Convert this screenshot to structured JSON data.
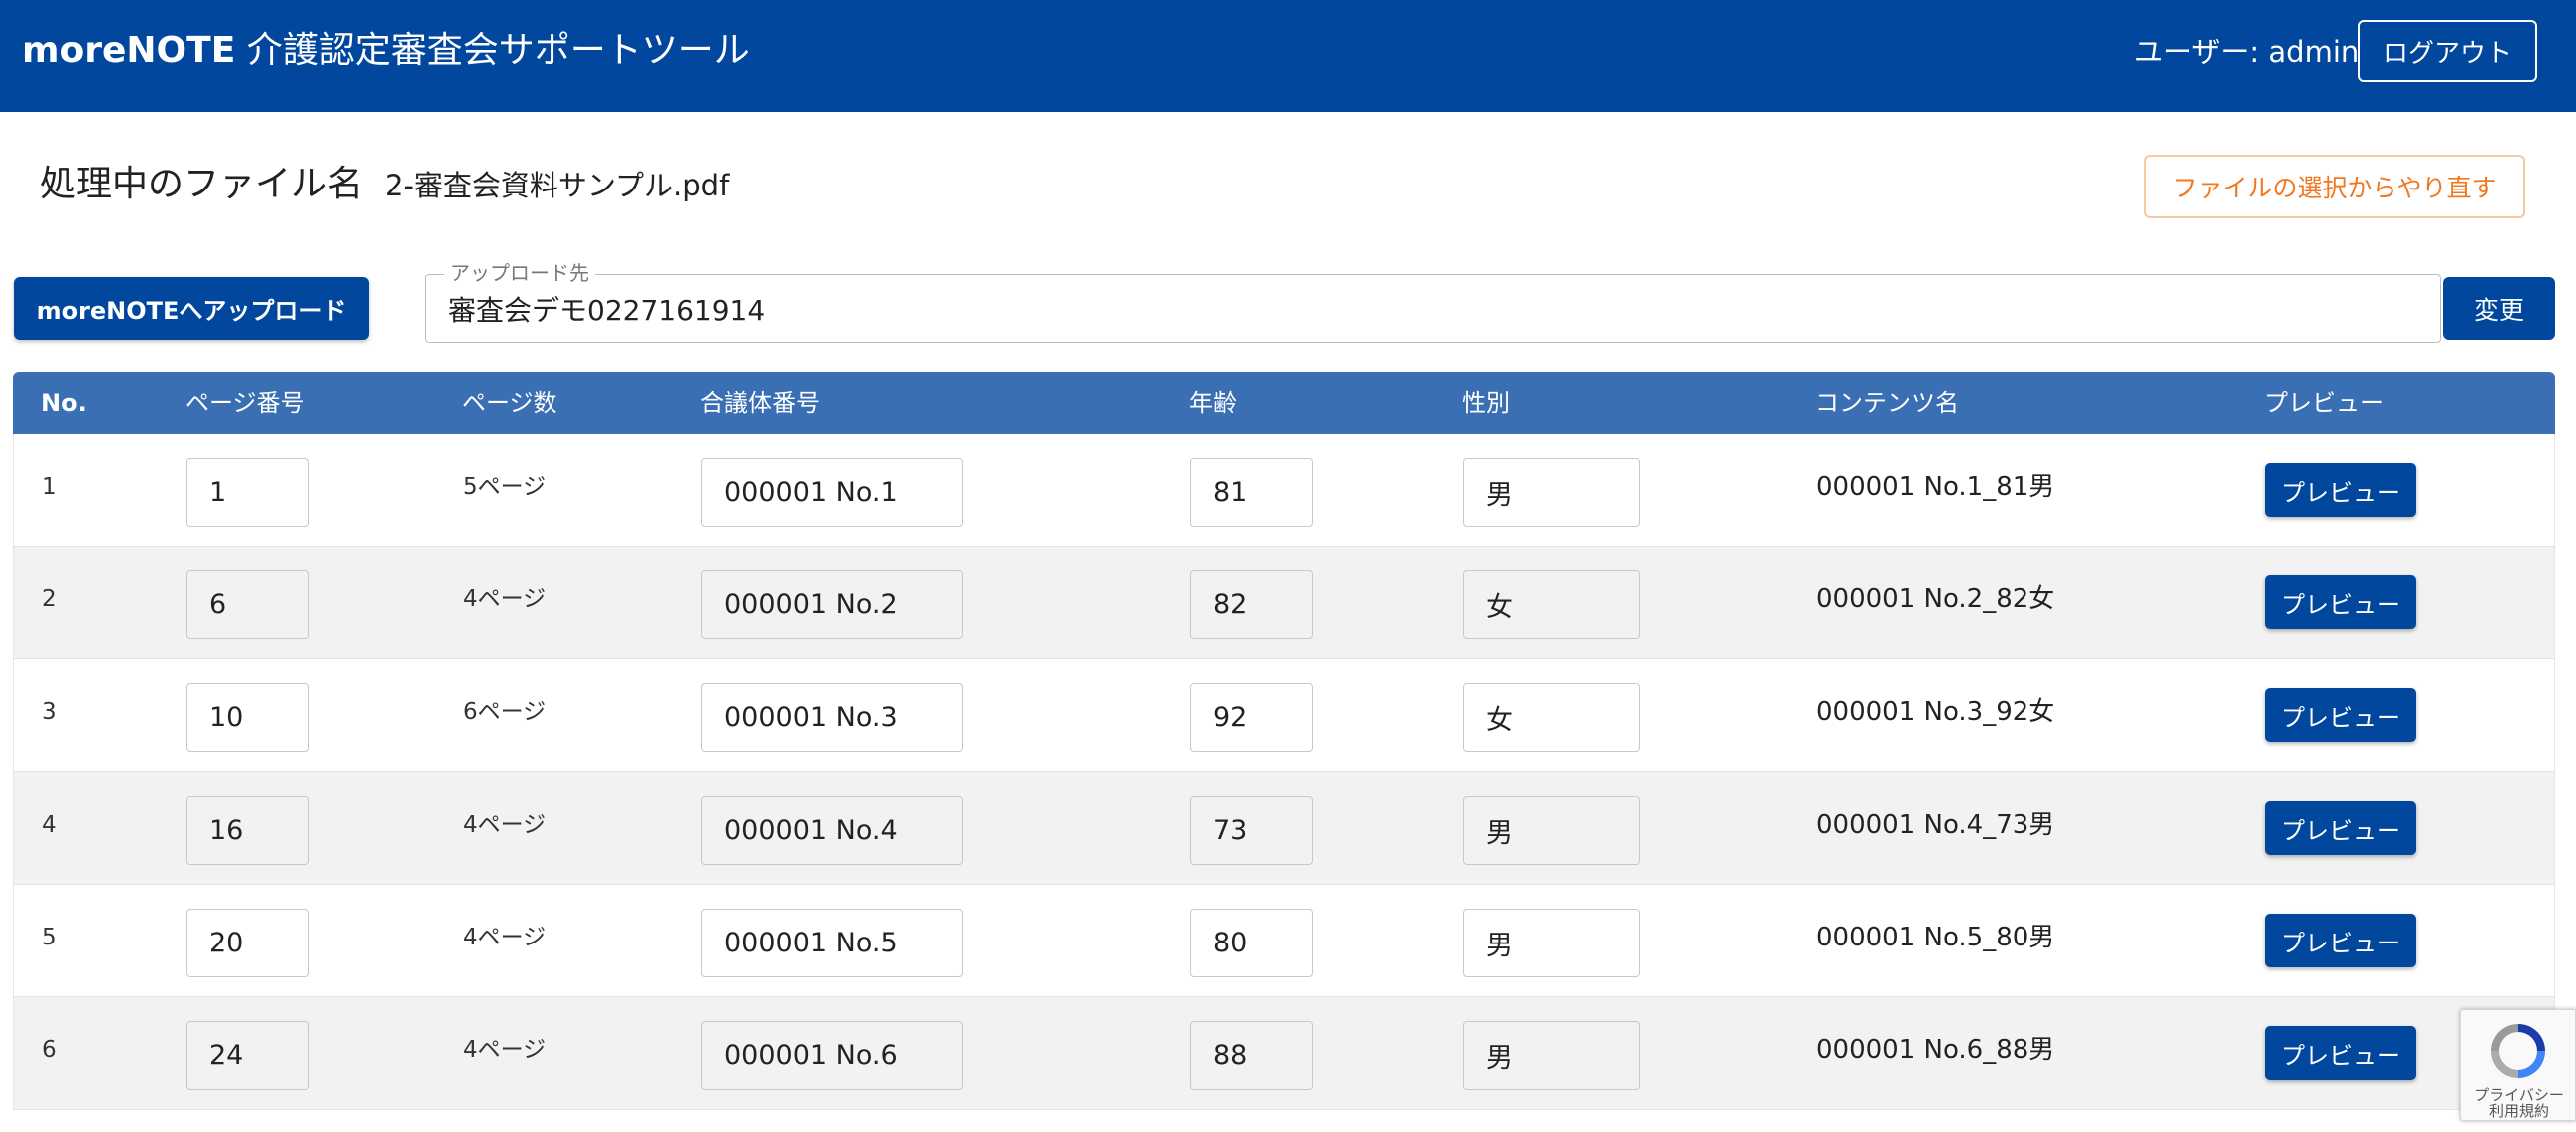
{
  "header": {
    "brand": "moreNOTE",
    "title_suffix": " 介護認定審査会サポートツール",
    "user_label": "ユーザー: admin",
    "logout_label": "ログアウト"
  },
  "file": {
    "heading": "処理中のファイル名",
    "name": "2-審査会資料サンプル.pdf",
    "reset_label": "ファイルの選択からやり直す"
  },
  "upload": {
    "button_label": "moreNOTEへアップロード",
    "destination_legend": "アップロード先",
    "destination_value": "審査会デモ0227161914",
    "change_label": "変更"
  },
  "table": {
    "headers": [
      "No.",
      "ページ番号",
      "ページ数",
      "合議体番号",
      "年齢",
      "性別",
      "コンテンツ名",
      "プレビュー"
    ],
    "rows": [
      {
        "no": "1",
        "page": "1",
        "pages": "5ページ",
        "group": "000001 No.1",
        "age": "81",
        "sex": "男",
        "content": "000001 No.1_81男",
        "preview": "プレビュー"
      },
      {
        "no": "2",
        "page": "6",
        "pages": "4ページ",
        "group": "000001 No.2",
        "age": "82",
        "sex": "女",
        "content": "000001 No.2_82女",
        "preview": "プレビュー"
      },
      {
        "no": "3",
        "page": "10",
        "pages": "6ページ",
        "group": "000001 No.3",
        "age": "92",
        "sex": "女",
        "content": "000001 No.3_92女",
        "preview": "プレビュー"
      },
      {
        "no": "4",
        "page": "16",
        "pages": "4ページ",
        "group": "000001 No.4",
        "age": "73",
        "sex": "男",
        "content": "000001 No.4_73男",
        "preview": "プレビュー"
      },
      {
        "no": "5",
        "page": "20",
        "pages": "4ページ",
        "group": "000001 No.5",
        "age": "80",
        "sex": "男",
        "content": "000001 No.5_80男",
        "preview": "プレビュー"
      },
      {
        "no": "6",
        "page": "24",
        "pages": "4ページ",
        "group": "000001 No.6",
        "age": "88",
        "sex": "男",
        "content": "000001 No.6_88男",
        "preview": "プレビュー"
      }
    ]
  },
  "recaptcha": {
    "privacy": "プライバシー",
    "terms": "利用規約"
  },
  "colors": {
    "header_bg": "#00479d",
    "table_header_bg": "#3a6fb4",
    "button_primary": "#00479d",
    "reset_accent": "#f0781e",
    "row_alt_bg": "#f2f2f2"
  }
}
